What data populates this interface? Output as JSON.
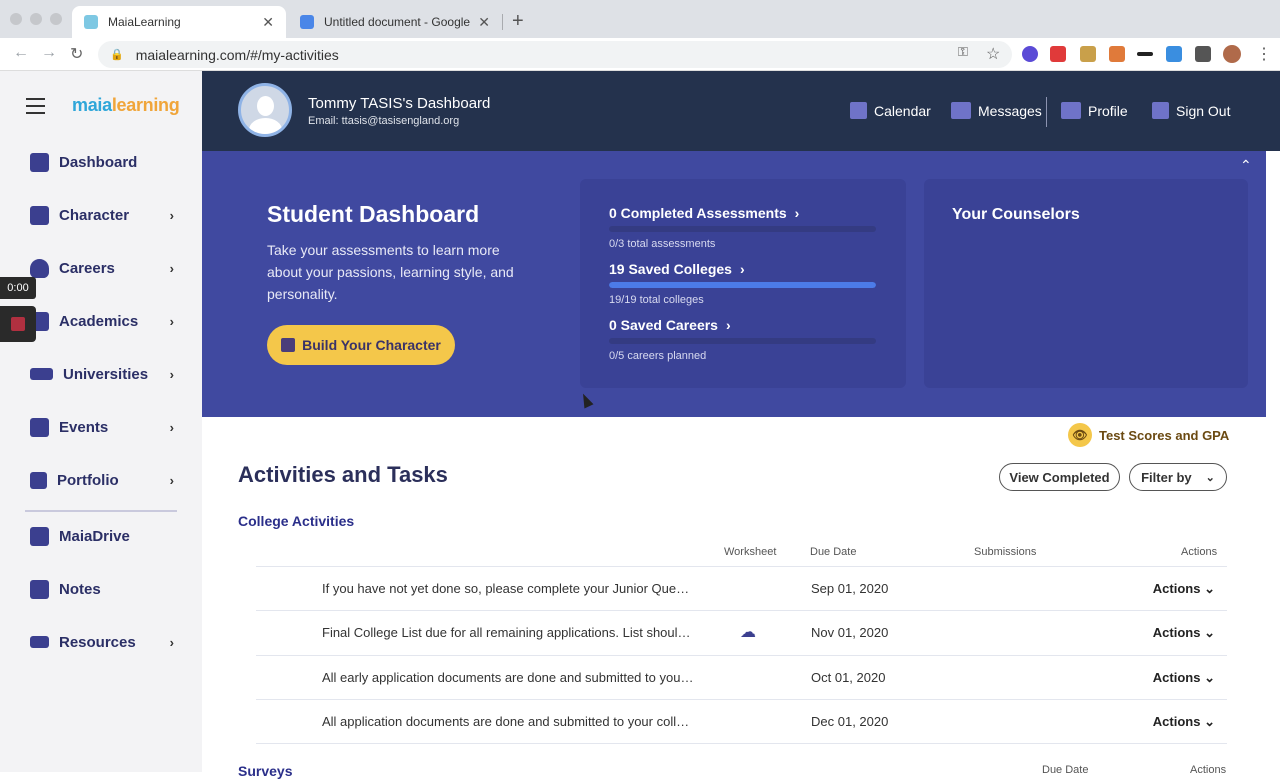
{
  "browser": {
    "tabs": [
      {
        "title": "MaiaLearning",
        "active": true
      },
      {
        "title": "Untitled document - Google Do",
        "active": false
      }
    ],
    "url": "maialearning.com/#/my-activities"
  },
  "recorder": {
    "time": "0:00"
  },
  "sidebar": {
    "logo_a": "maia",
    "logo_b": "learning",
    "items": [
      {
        "label": "Dashboard"
      },
      {
        "label": "Character"
      },
      {
        "label": "Careers"
      },
      {
        "label": "Academics"
      },
      {
        "label": "Universities"
      },
      {
        "label": "Events"
      },
      {
        "label": "Portfolio"
      },
      {
        "label": "MaiaDrive"
      },
      {
        "label": "Notes"
      },
      {
        "label": "Resources"
      }
    ]
  },
  "header": {
    "user_name": "Tommy TASIS's Dashboard",
    "user_email": "Email: ttasis@tasisengland.org",
    "nav": {
      "calendar": "Calendar",
      "messages": "Messages",
      "profile": "Profile",
      "signout": "Sign Out"
    }
  },
  "hero": {
    "title": "Student Dashboard",
    "description": "Take your assessments to learn more about your passions, learning style, and personality.",
    "button": "Build Your Character",
    "stats": [
      {
        "title": "0 Completed Assessments",
        "sub": "0/3 total assessments",
        "progress": 0.0
      },
      {
        "title": "19 Saved Colleges",
        "sub": "19/19 total colleges",
        "progress": 1.0
      },
      {
        "title": "0 Saved Careers",
        "sub": "0/5 careers planned",
        "progress": 0.0
      }
    ],
    "counselors_title": "Your Counselors"
  },
  "main": {
    "test_scores": "Test Scores and GPA",
    "title": "Activities and Tasks",
    "view_completed": "View Completed",
    "filter_by": "Filter by",
    "college_section": "College Activities",
    "headers": {
      "worksheet": "Worksheet",
      "due_date": "Due Date",
      "submissions": "Submissions",
      "actions": "Actions"
    },
    "rows": [
      {
        "text": "If you have not yet done so, please complete your Junior Questionnaire",
        "date": "Sep 01, 2020",
        "action": "Actions"
      },
      {
        "text": "Final College List due for all remaining applications. List should be finalized",
        "date": "Nov 01, 2020",
        "action": "Actions"
      },
      {
        "text": "All early application documents are done and submitted to your counselor",
        "date": "Oct 01, 2020",
        "action": "Actions"
      },
      {
        "text": "All application documents are done and submitted to your college counselor",
        "date": "Dec 01, 2020",
        "action": "Actions"
      }
    ],
    "surveys_section": "Surveys",
    "surveys_headers": {
      "due_date": "Due Date",
      "actions": "Actions"
    }
  },
  "colors": {
    "sidebar_bg": "#f3f3f5",
    "topbar_bg": "#24324d",
    "hero_bg": "#4049a0",
    "accent_yellow": "#f4c74a",
    "progress_blue": "#4c7be8"
  }
}
